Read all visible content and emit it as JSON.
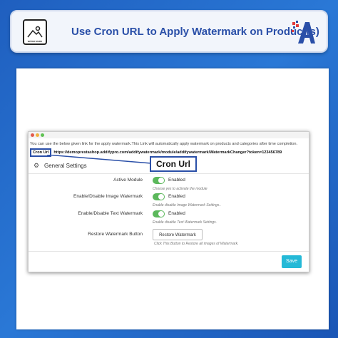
{
  "header": {
    "icon_caption": "WATER MARK",
    "title": "Use Cron URL to Apply Watermark on Product(s)"
  },
  "screenshot": {
    "info_text": "You can use the below given link for the apply watermark.This Link will automatically apply watermark on products and categories after time completion.",
    "cron_label": "Cron Url",
    "cron_url": "https://demoprestashop.addifypro.com/addifywatermark/module/addifywatermark/WatermarkChanger?token=123456789",
    "callout": "Cron Url",
    "section_title": "General Settings",
    "rows": [
      {
        "label": "Active Module",
        "value": "Enabled",
        "hint": "Choose yes to activate the module"
      },
      {
        "label": "Enable/Disable Image Watermark",
        "value": "Enabled",
        "hint": "Enable disable Image Watermark Settings.."
      },
      {
        "label": "Enable/Disable Text Watermark",
        "value": "Enabled",
        "hint": "Enable disable Text Watermark Settings."
      }
    ],
    "restore": {
      "label": "Restore Watermark Button",
      "button": "Restore Watermark",
      "hint": "Click This Button to Restore all images of Watermark."
    },
    "save_button": "Save"
  },
  "colors": {
    "background": "#2a78d6",
    "title": "#2a4fa8",
    "toggle": "#5cb85c",
    "save": "#25b9d7"
  },
  "icons": {
    "header_left": "watermark-image-icon",
    "header_right": "brand-logo",
    "section": "gears-icon"
  }
}
